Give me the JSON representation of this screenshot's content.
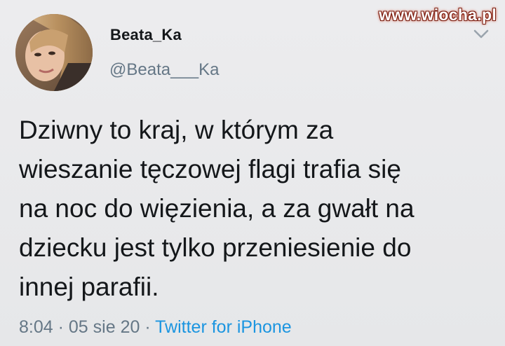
{
  "watermark": "www.wiocha.pl",
  "author": {
    "display_name": "Beata_Ka",
    "handle": "@Beata___Ka"
  },
  "tweet": {
    "lines": [
      "Dziwny to kraj, w którym za",
      "wieszanie tęczowej flagi trafia się",
      "na noc do więzienia, a za gwałt na",
      "dziecku jest tylko przeniesienie do",
      "innej parafii."
    ],
    "time": "8:04",
    "separator": "·",
    "date": "05 sie 20",
    "source": "Twitter for iPhone"
  },
  "icons": {
    "more": "chevron-down-icon"
  },
  "colors": {
    "background": "#e9eaec",
    "text": "#14171a",
    "secondary": "#657786",
    "link": "#1b95e0"
  }
}
